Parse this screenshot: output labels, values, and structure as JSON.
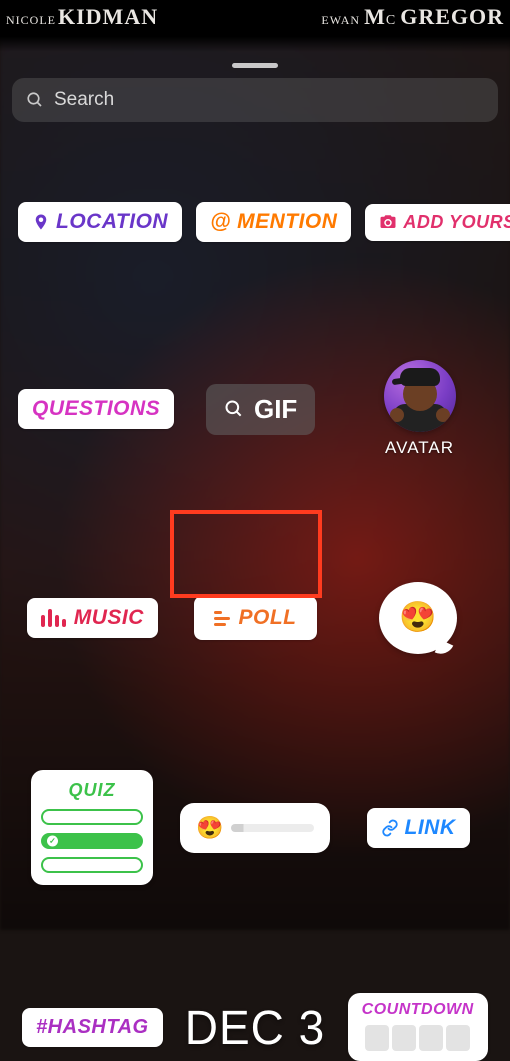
{
  "credits": {
    "left_first": "NICOLE",
    "left_last": "KIDMAN",
    "right_first": "EWAN",
    "right_last_a": "M",
    "right_last_b": "C",
    "right_last_c": "GREGOR"
  },
  "search": {
    "placeholder": "Search"
  },
  "stickers": {
    "location": "LOCATION",
    "mention": "MENTION",
    "add_yours": "ADD YOURS",
    "questions": "QUESTIONS",
    "gif": "GIF",
    "avatar": "AVATAR",
    "music": "MUSIC",
    "poll": "POLL",
    "quiz": "QUIZ",
    "link": "LINK",
    "hashtag": "#HASHTAG",
    "date": "DEC 3",
    "countdown": "COUNTDOWN"
  },
  "icons": {
    "mention_prefix": "@",
    "heart_eyes": "😍"
  },
  "highlight": {
    "target": "poll"
  }
}
